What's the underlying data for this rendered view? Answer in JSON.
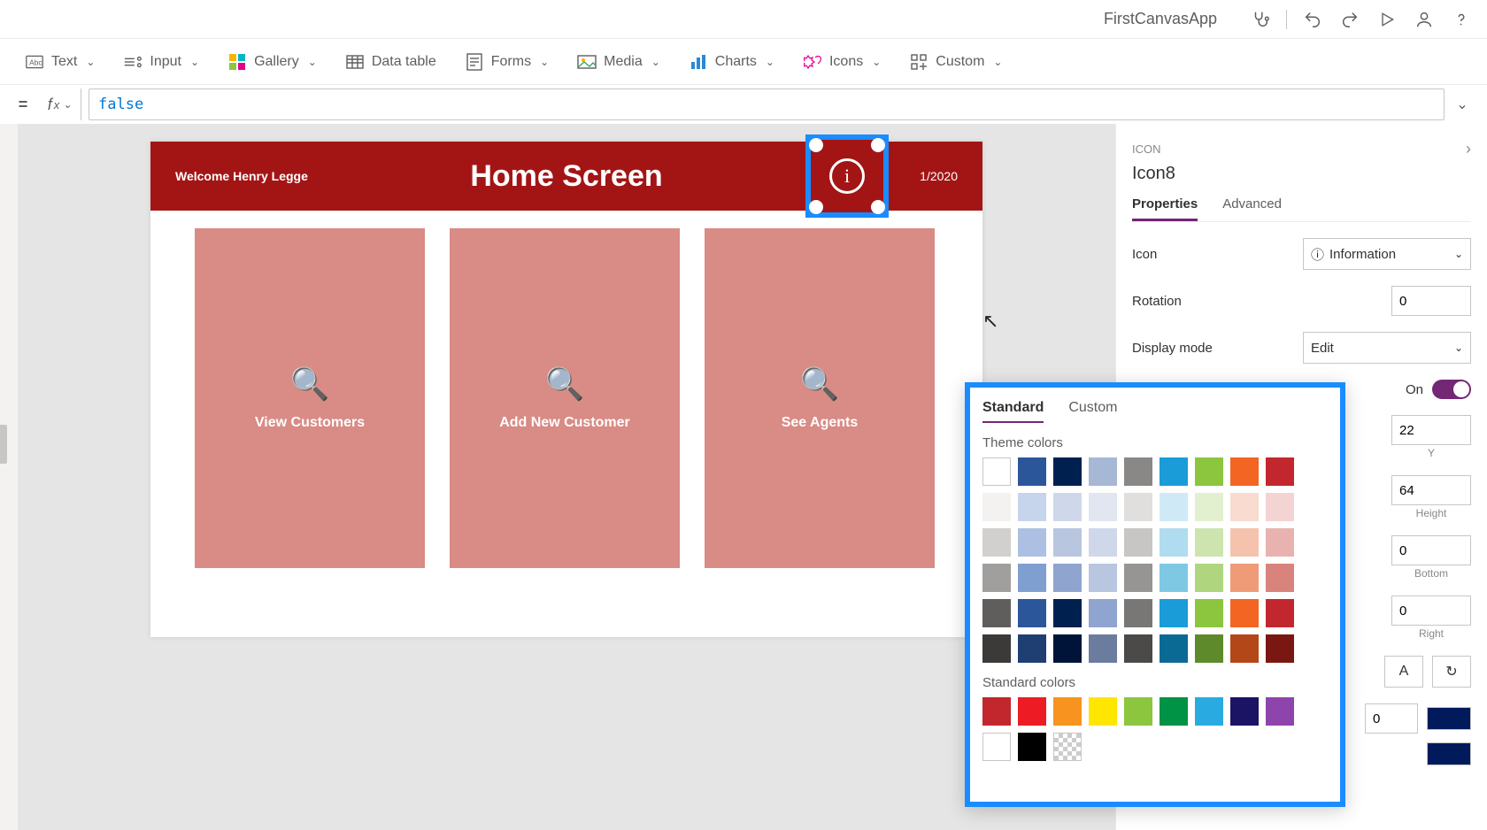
{
  "titlebar": {
    "app_title": "FirstCanvasApp"
  },
  "ribbon": {
    "text": "Text",
    "input": "Input",
    "gallery": "Gallery",
    "datatable": "Data table",
    "forms": "Forms",
    "media": "Media",
    "charts": "Charts",
    "icons": "Icons",
    "custom": "Custom"
  },
  "formula": {
    "value": "false"
  },
  "app": {
    "welcome": "Welcome Henry Legge",
    "title": "Home Screen",
    "date": "1/2020",
    "card1": "View Customers",
    "card2": "Add New Customer",
    "card3": "See Agents"
  },
  "props": {
    "crumb": "ICON",
    "name": "Icon8",
    "tab_properties": "Properties",
    "tab_advanced": "Advanced",
    "icon_label": "Icon",
    "icon_value": "Information",
    "rotation_label": "Rotation",
    "rotation_value": "0",
    "display_label": "Display mode",
    "display_value": "Edit",
    "toggle_label": "On",
    "pos_y_value": "22",
    "pos_y_caption": "Y",
    "size_h_value": "64",
    "size_h_caption": "Height",
    "pad_b_value": "0",
    "pad_b_caption": "Bottom",
    "pad_r_value": "0",
    "pad_r_caption": "Right",
    "font_letter": "A",
    "rotate_icon": "↻",
    "num_zero": "0"
  },
  "colorpopup": {
    "tab_standard": "Standard",
    "tab_custom": "Custom",
    "theme_label": "Theme colors",
    "standard_label": "Standard colors",
    "theme_rows": [
      [
        "#ffffff",
        "#2b579a",
        "#002050",
        "#a6b8d4",
        "#8a8886",
        "#1a9cd8",
        "#8cc63f",
        "#f26522",
        "#c1272d"
      ],
      [
        "#f3f2f1",
        "#c6d4ec",
        "#cfd7ea",
        "#e1e6f0",
        "#e1dfdd",
        "#cfeaf6",
        "#e3f0cf",
        "#fadbcf",
        "#f3d4d2"
      ],
      [
        "#d2d0ce",
        "#adc0e4",
        "#b9c6e0",
        "#cfd7ea",
        "#c8c6c4",
        "#afdcee",
        "#cee4af",
        "#f5c2ad",
        "#e8b2ae"
      ],
      [
        "#a19f9d",
        "#7f9fd1",
        "#8fa4cf",
        "#b9c6e0",
        "#979593",
        "#7fc8e4",
        "#afd57f",
        "#ef9b77",
        "#d9837d"
      ],
      [
        "#605e5c",
        "#2b579a",
        "#002050",
        "#8fa4cf",
        "#797775",
        "#1a9cd8",
        "#8cc63f",
        "#f26522",
        "#c1272d"
      ],
      [
        "#3b3a39",
        "#1f3f73",
        "#001338",
        "#6b7c9e",
        "#4b4a48",
        "#0b6a94",
        "#5f8a2b",
        "#b44717",
        "#7a1713"
      ]
    ],
    "standard_row": [
      "#c1272d",
      "#ed1c24",
      "#f7931e",
      "#ffe600",
      "#8cc63f",
      "#009245",
      "#29abe2",
      "#1b1464",
      "#8e44ad"
    ],
    "standard_row2": [
      "#ffffff",
      "#000000",
      "trans"
    ]
  }
}
